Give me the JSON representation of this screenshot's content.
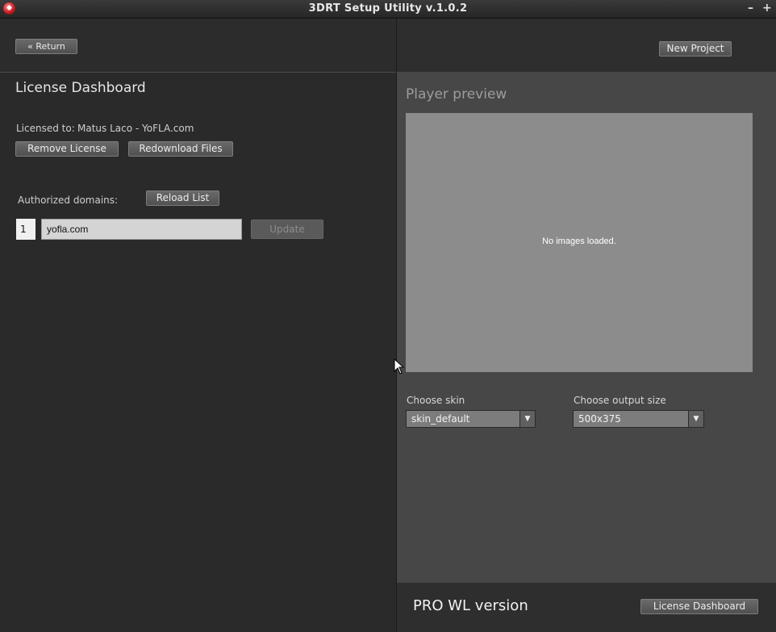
{
  "window": {
    "title": "3DRT Setup Utility v.1.0.2",
    "controls": [
      "–",
      "+",
      "×"
    ]
  },
  "left": {
    "return_label": "« Return",
    "heading": "License Dashboard",
    "licensed_to_label": "Licensed to:",
    "licensed_to_value": "Matus Laco - YoFLA.com",
    "remove_license_label": "Remove License",
    "redownload_label": "Redownload Files",
    "authorized_domains_label": "Authorized domains:",
    "reload_list_label": "Reload List",
    "domains": [
      {
        "index": "1",
        "value": "yofla.com"
      }
    ],
    "update_label": "Update"
  },
  "right": {
    "new_project_label": "New Project",
    "preview_heading": "Player preview",
    "preview_empty_text": "No images loaded.",
    "skin_label": "Choose skin",
    "skin_value": "skin_default",
    "output_size_label": "Choose output size",
    "output_size_value": "500x375"
  },
  "footer": {
    "version_label": "PRO WL version",
    "license_dashboard_label": "License Dashboard"
  },
  "colors": {
    "left_bg": "#2a2a2a",
    "right_bg": "#474747",
    "preview_bg": "#8c8c8c",
    "brand_red": "#c4161c"
  },
  "icons": {
    "app": "app-logo-icon",
    "dropdown": "chevron-down-icon",
    "cursor": "mouse-pointer-icon"
  }
}
